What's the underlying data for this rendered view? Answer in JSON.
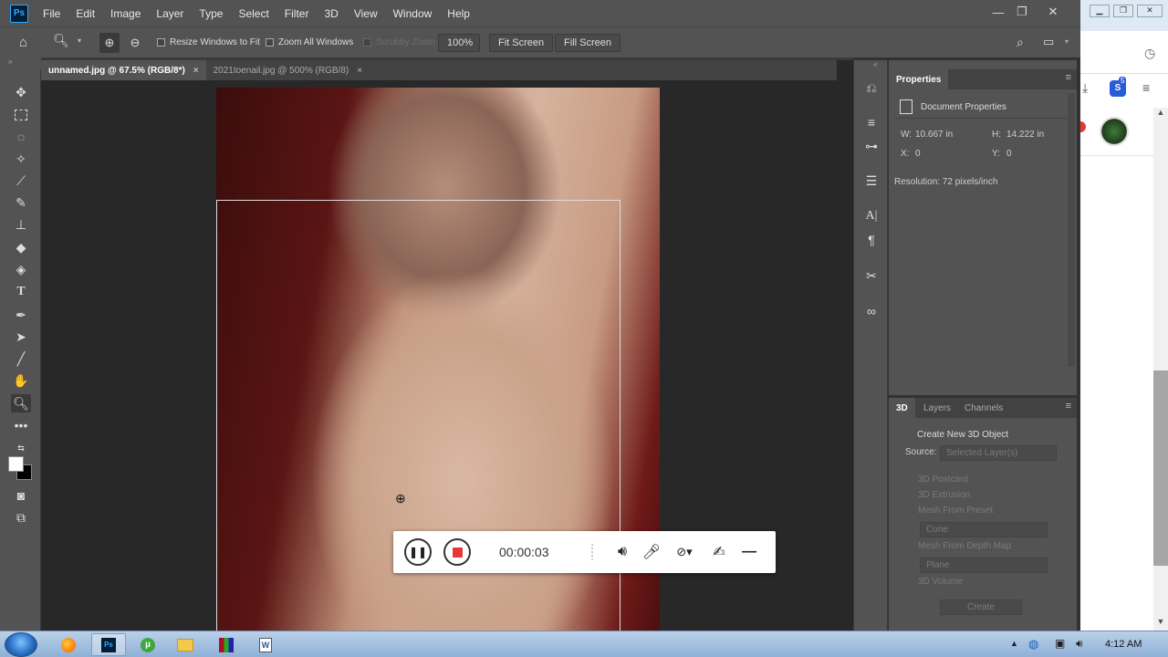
{
  "menubar": {
    "logo": "Ps",
    "items": [
      "File",
      "Edit",
      "Image",
      "Layer",
      "Type",
      "Select",
      "Filter",
      "3D",
      "View",
      "Window",
      "Help"
    ]
  },
  "options": {
    "resize_windows": "Resize Windows to Fit",
    "zoom_all": "Zoom All Windows",
    "scrubby_zoom": "Scrubby Zoom",
    "zoom_value": "100%",
    "fit_screen": "Fit Screen",
    "fill_screen": "Fill Screen"
  },
  "tabs": [
    {
      "label": "unnamed.jpg @ 67.5% (RGB/8*)",
      "close": "×"
    },
    {
      "label": "2021toenail.jpg @ 500% (RGB/8)",
      "close": "×"
    }
  ],
  "recorder": {
    "time": "00:00:03"
  },
  "properties": {
    "tab": "Properties",
    "doc_props": "Document Properties",
    "w_label": "W:",
    "w_value": "10.667 in",
    "h_label": "H:",
    "h_value": "14.222 in",
    "x_label": "X:",
    "x_value": "0",
    "y_label": "Y:",
    "y_value": "0",
    "resolution": "Resolution: 72 pixels/inch"
  },
  "panel3d": {
    "tabs": [
      "3D",
      "Layers",
      "Channels"
    ],
    "heading": "Create New 3D Object",
    "source_label": "Source:",
    "source_value": "Selected Layer(s)",
    "options": [
      "3D Postcard",
      "3D Extrusion",
      "Mesh From Preset"
    ],
    "preset_value": "Cone",
    "depth_map": "Mesh From Depth Map",
    "depth_value": "Plane",
    "volume": "3D Volume",
    "create": "Create"
  },
  "browser": {
    "badge": "5"
  },
  "taskbar": {
    "time": "4:12 AM"
  },
  "colors": {
    "accent": "#31a8ff",
    "record_red": "#e53935"
  }
}
